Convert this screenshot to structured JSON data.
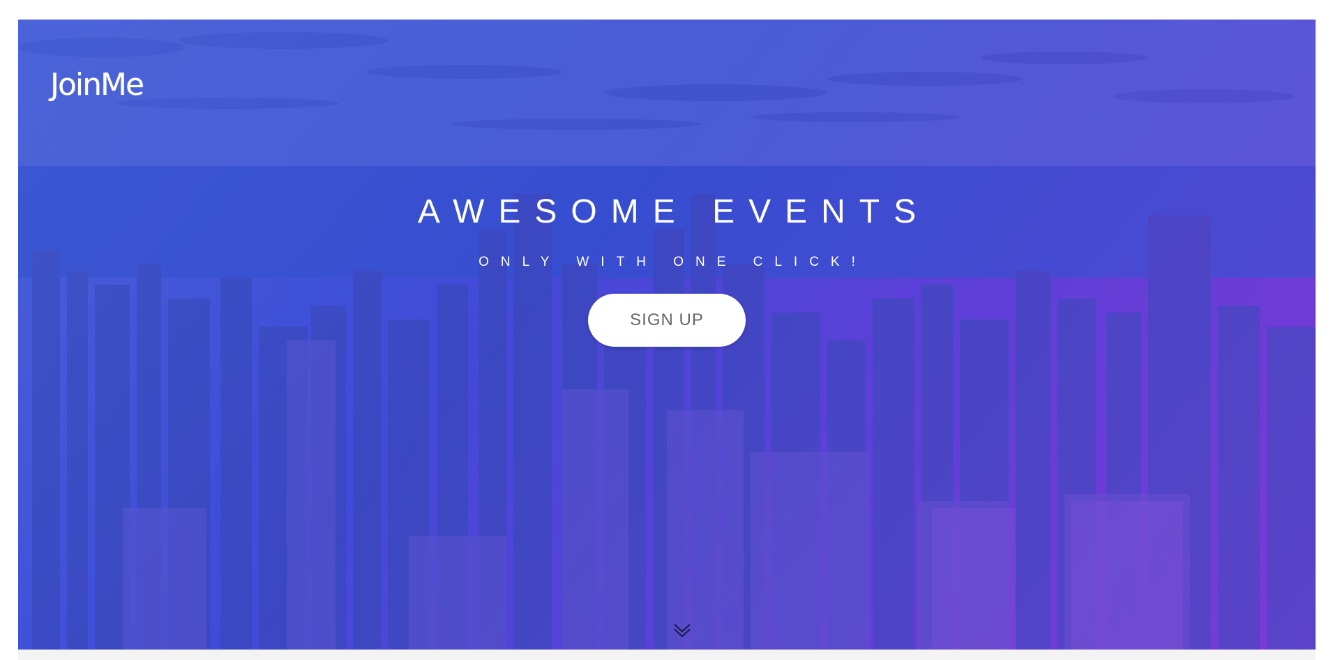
{
  "brand": {
    "logo_text": "JoinMe"
  },
  "hero": {
    "title": "AWESOME EVENTS",
    "subtitle": "ONLY WITH ONE CLICK!",
    "cta_label": "SIGN UP",
    "scroll_icon": "double-chevron-down-icon"
  },
  "colors": {
    "overlay_start": "#4d5fd6",
    "overlay_mid": "#3f4fd8",
    "overlay_end": "#7a35d6",
    "button_bg": "#ffffff",
    "button_text": "#666666"
  }
}
